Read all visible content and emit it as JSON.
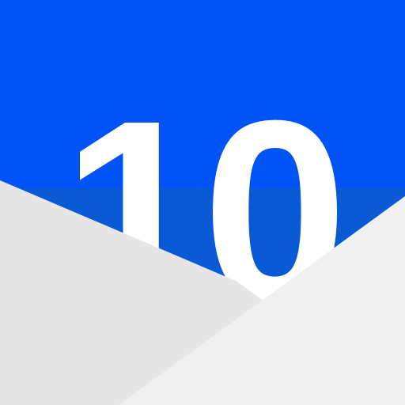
{
  "icon": {
    "number": "10",
    "colors": {
      "blue_top": "#0054f5",
      "blue_bottom": "#0a5ad6",
      "number_fill": "#ffffff",
      "envelope_left": "#e6e6e6",
      "envelope_right": "#f0f0f0",
      "background": "#ffffff"
    }
  }
}
